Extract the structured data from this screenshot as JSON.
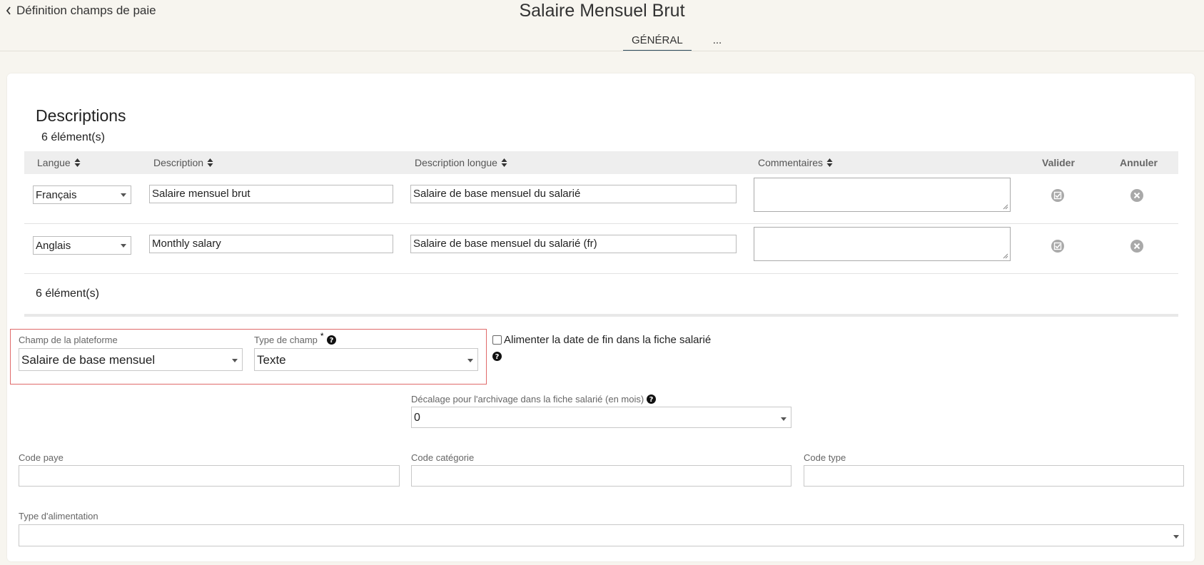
{
  "header": {
    "back_label": "Définition champs de paie",
    "title": "Salaire Mensuel Brut",
    "tabs": [
      {
        "label": "GÉNÉRAL"
      },
      {
        "label": "..."
      }
    ]
  },
  "descriptions": {
    "title": "Descriptions",
    "count_top": "6 élément(s)",
    "count_bottom": "6 élément(s)",
    "columns": {
      "langue": "Langue",
      "description": "Description",
      "description_longue": "Description longue",
      "commentaires": "Commentaires",
      "valider": "Valider",
      "annuler": "Annuler"
    },
    "rows": [
      {
        "langue": "Français",
        "description": "Salaire mensuel brut",
        "description_longue": "Salaire de base mensuel du salarié",
        "commentaires": ""
      },
      {
        "langue": "Anglais",
        "description": "Monthly salary",
        "description_longue": "Salaire de base mensuel du salarié (fr)",
        "commentaires": ""
      }
    ]
  },
  "form": {
    "champ_plateforme": {
      "label": "Champ de la plateforme",
      "value": "Salaire de base mensuel"
    },
    "type_champ": {
      "label": "Type de champ",
      "required_mark": "*",
      "value": "Texte"
    },
    "alimenter_date_fin": {
      "label": "Alimenter la date de fin dans la fiche salarié",
      "checked": false
    },
    "decalage": {
      "label": "Décalage pour l'archivage dans la fiche salarié (en mois)",
      "value": "0"
    },
    "code_paye": {
      "label": "Code paye",
      "value": ""
    },
    "code_categorie": {
      "label": "Code catégorie",
      "value": ""
    },
    "code_type": {
      "label": "Code type",
      "value": ""
    },
    "type_alimentation": {
      "label": "Type d'alimentation",
      "value": ""
    }
  },
  "colors": {
    "accent": "#2c4b5e",
    "highlight_border": "#e06a6a",
    "background": "#f7f5ef"
  }
}
